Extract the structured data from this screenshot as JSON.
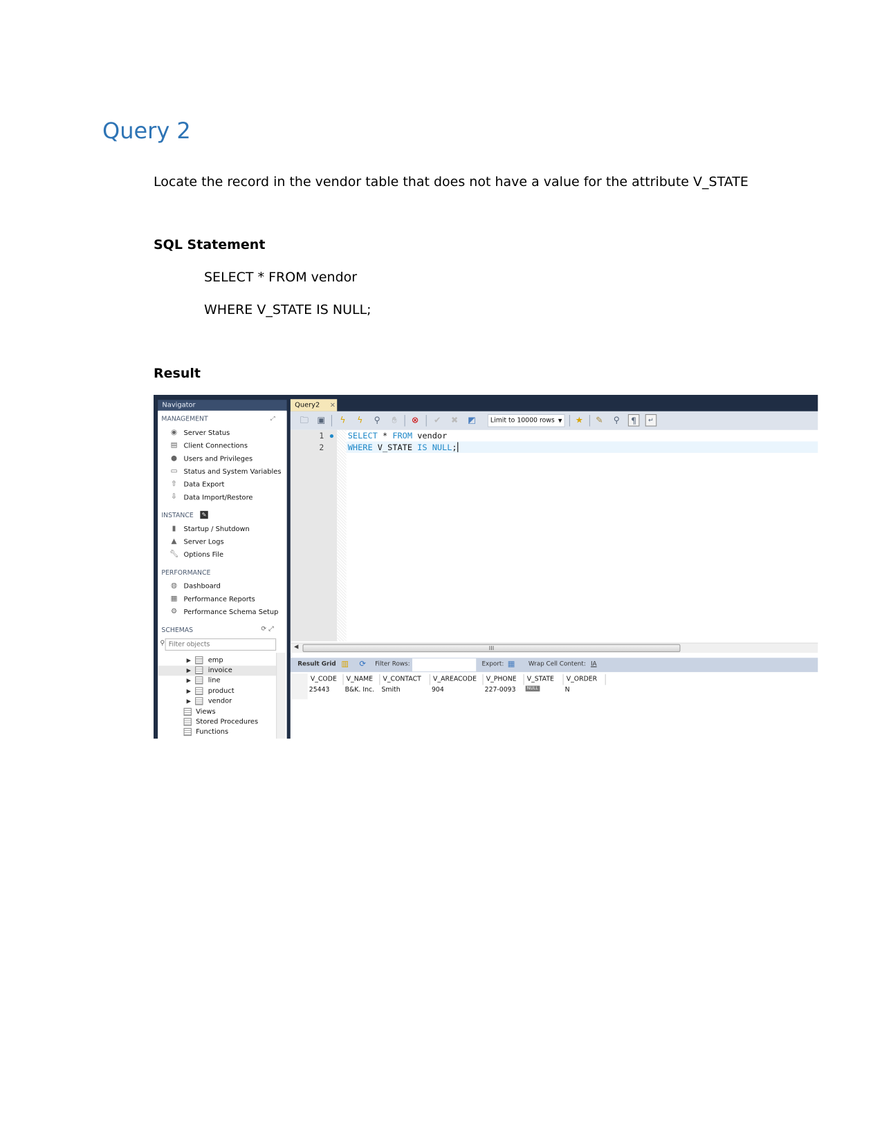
{
  "document": {
    "title": "Query 2",
    "description": "Locate the record in the vendor table that does not have a value for the attribute V_STATE",
    "sql_heading": "SQL Statement",
    "sql_lines": [
      "SELECT * FROM vendor",
      "WHERE V_STATE IS NULL;"
    ],
    "result_heading": "Result"
  },
  "workbench": {
    "navigator_title": "Navigator",
    "management": {
      "label": "MANAGEMENT",
      "items": [
        "Server Status",
        "Client Connections",
        "Users and Privileges",
        "Status and System Variables",
        "Data Export",
        "Data Import/Restore"
      ]
    },
    "instance": {
      "label": "INSTANCE",
      "items": [
        "Startup / Shutdown",
        "Server Logs",
        "Options File"
      ]
    },
    "performance": {
      "label": "PERFORMANCE",
      "items": [
        "Dashboard",
        "Performance Reports",
        "Performance Schema Setup"
      ]
    },
    "schemas": {
      "label": "SCHEMAS",
      "filter_placeholder": "Filter objects",
      "tables": [
        "emp",
        "invoice",
        "line",
        "product",
        "vendor"
      ],
      "folders": [
        "Views",
        "Stored Procedures",
        "Functions"
      ]
    },
    "tab_label": "Query2",
    "tab_close": "×",
    "limit_select": "Limit to 10000 rows",
    "editor": {
      "line_numbers": [
        "1",
        "2"
      ],
      "line1": {
        "kw1": "SELECT",
        "op": " * ",
        "kw2": "FROM",
        "rest": " vendor"
      },
      "line2": {
        "kw1": "WHERE",
        "mid": " V_STATE ",
        "kw2": "IS NULL",
        "rest": ";"
      }
    },
    "result_toolbar": {
      "result_grid": "Result Grid",
      "filter_rows": "Filter Rows:",
      "export": "Export:",
      "wrap": "Wrap Cell Content:"
    },
    "grid": {
      "columns": [
        "V_CODE",
        "V_NAME",
        "V_CONTACT",
        "V_AREACODE",
        "V_PHONE",
        "V_STATE",
        "V_ORDER"
      ],
      "rows": [
        [
          "25443",
          "B&K. Inc.",
          "Smith",
          "904",
          "227-0093",
          "NULL",
          "N"
        ]
      ]
    },
    "colors": {
      "title": "#2e74b5",
      "frame": "#1f2d44",
      "keyword": "#1e88c8",
      "tab": "#f6e7b9"
    }
  }
}
